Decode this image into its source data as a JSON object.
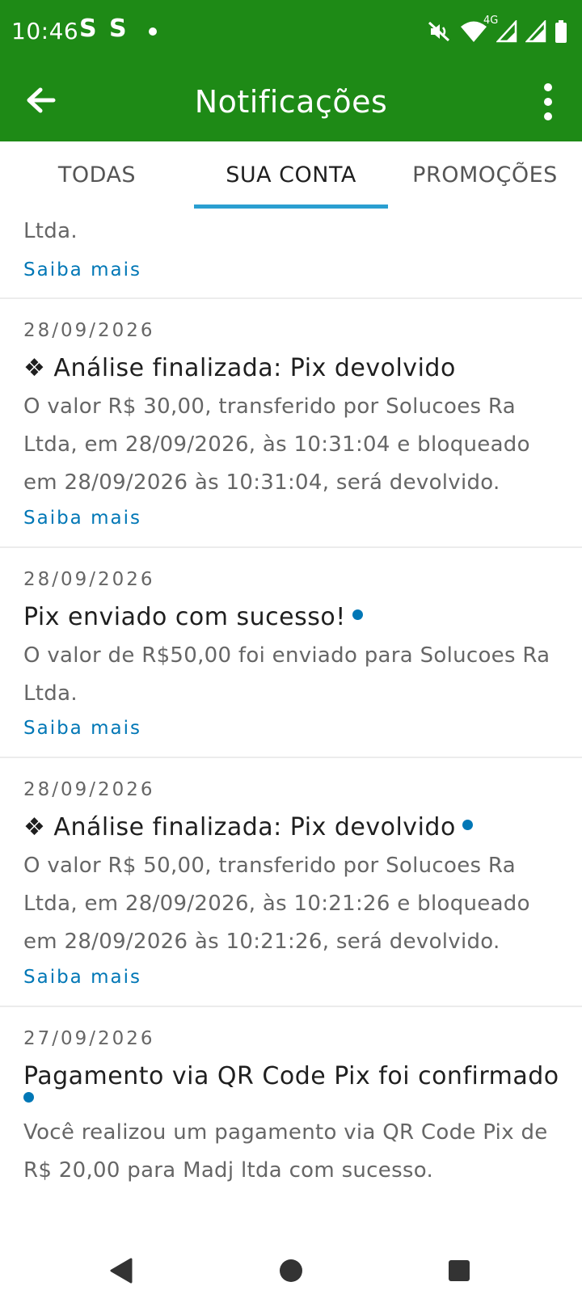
{
  "status_bar": {
    "time": "10:46",
    "app_icons": [
      "S",
      "S"
    ],
    "icons": [
      "mute-icon",
      "wifi-icon",
      "signal-icon",
      "signal-icon",
      "battery-icon"
    ],
    "network_label": "4G"
  },
  "app_bar": {
    "title": "Notificações",
    "back_icon": "arrow-left-icon",
    "menu_icon": "more-vert-icon",
    "color": "#1e8a16"
  },
  "tabs": [
    {
      "label": "TODAS",
      "active": false
    },
    {
      "label": "SUA CONTA",
      "active": true
    },
    {
      "label": "PROMOÇÕES",
      "active": false
    }
  ],
  "notifications": [
    {
      "partial": true,
      "body": "Ltda.",
      "link": "Saiba mais"
    },
    {
      "date": "28/09/2026",
      "title": "❖ Análise finalizada: Pix devolvido",
      "unread": false,
      "body": "O valor R$ 30,00, transferido por Solucoes Ra Ltda, em 28/09/2026, às 10:31:04 e bloqueado em 28/09/2026 às 10:31:04, será devolvido.",
      "link": "Saiba mais"
    },
    {
      "date": "28/09/2026",
      "title": "Pix enviado com sucesso!",
      "unread": true,
      "body": "O valor de R$50,00 foi enviado para Solucoes Ra Ltda.",
      "link": "Saiba mais"
    },
    {
      "date": "28/09/2026",
      "title": "❖ Análise finalizada: Pix devolvido",
      "unread": true,
      "body": "O valor R$ 50,00, transferido por Solucoes Ra Ltda, em 28/09/2026, às 10:21:26 e bloqueado em 28/09/2026 às 10:21:26, será devolvido.",
      "link": "Saiba mais"
    },
    {
      "date": "27/09/2026",
      "title": "Pagamento via QR Code Pix foi confirmado",
      "unread": true,
      "body": "Você realizou um pagamento via QR Code Pix de R$ 20,00 para Madj ltda com sucesso."
    }
  ],
  "nav_bar": {
    "icons": [
      "back-triangle-icon",
      "home-circle-icon",
      "recents-square-icon"
    ]
  },
  "colors": {
    "accent": "#1e8a16",
    "link": "#0077b6",
    "tab_indicator": "#2a9fd1"
  }
}
